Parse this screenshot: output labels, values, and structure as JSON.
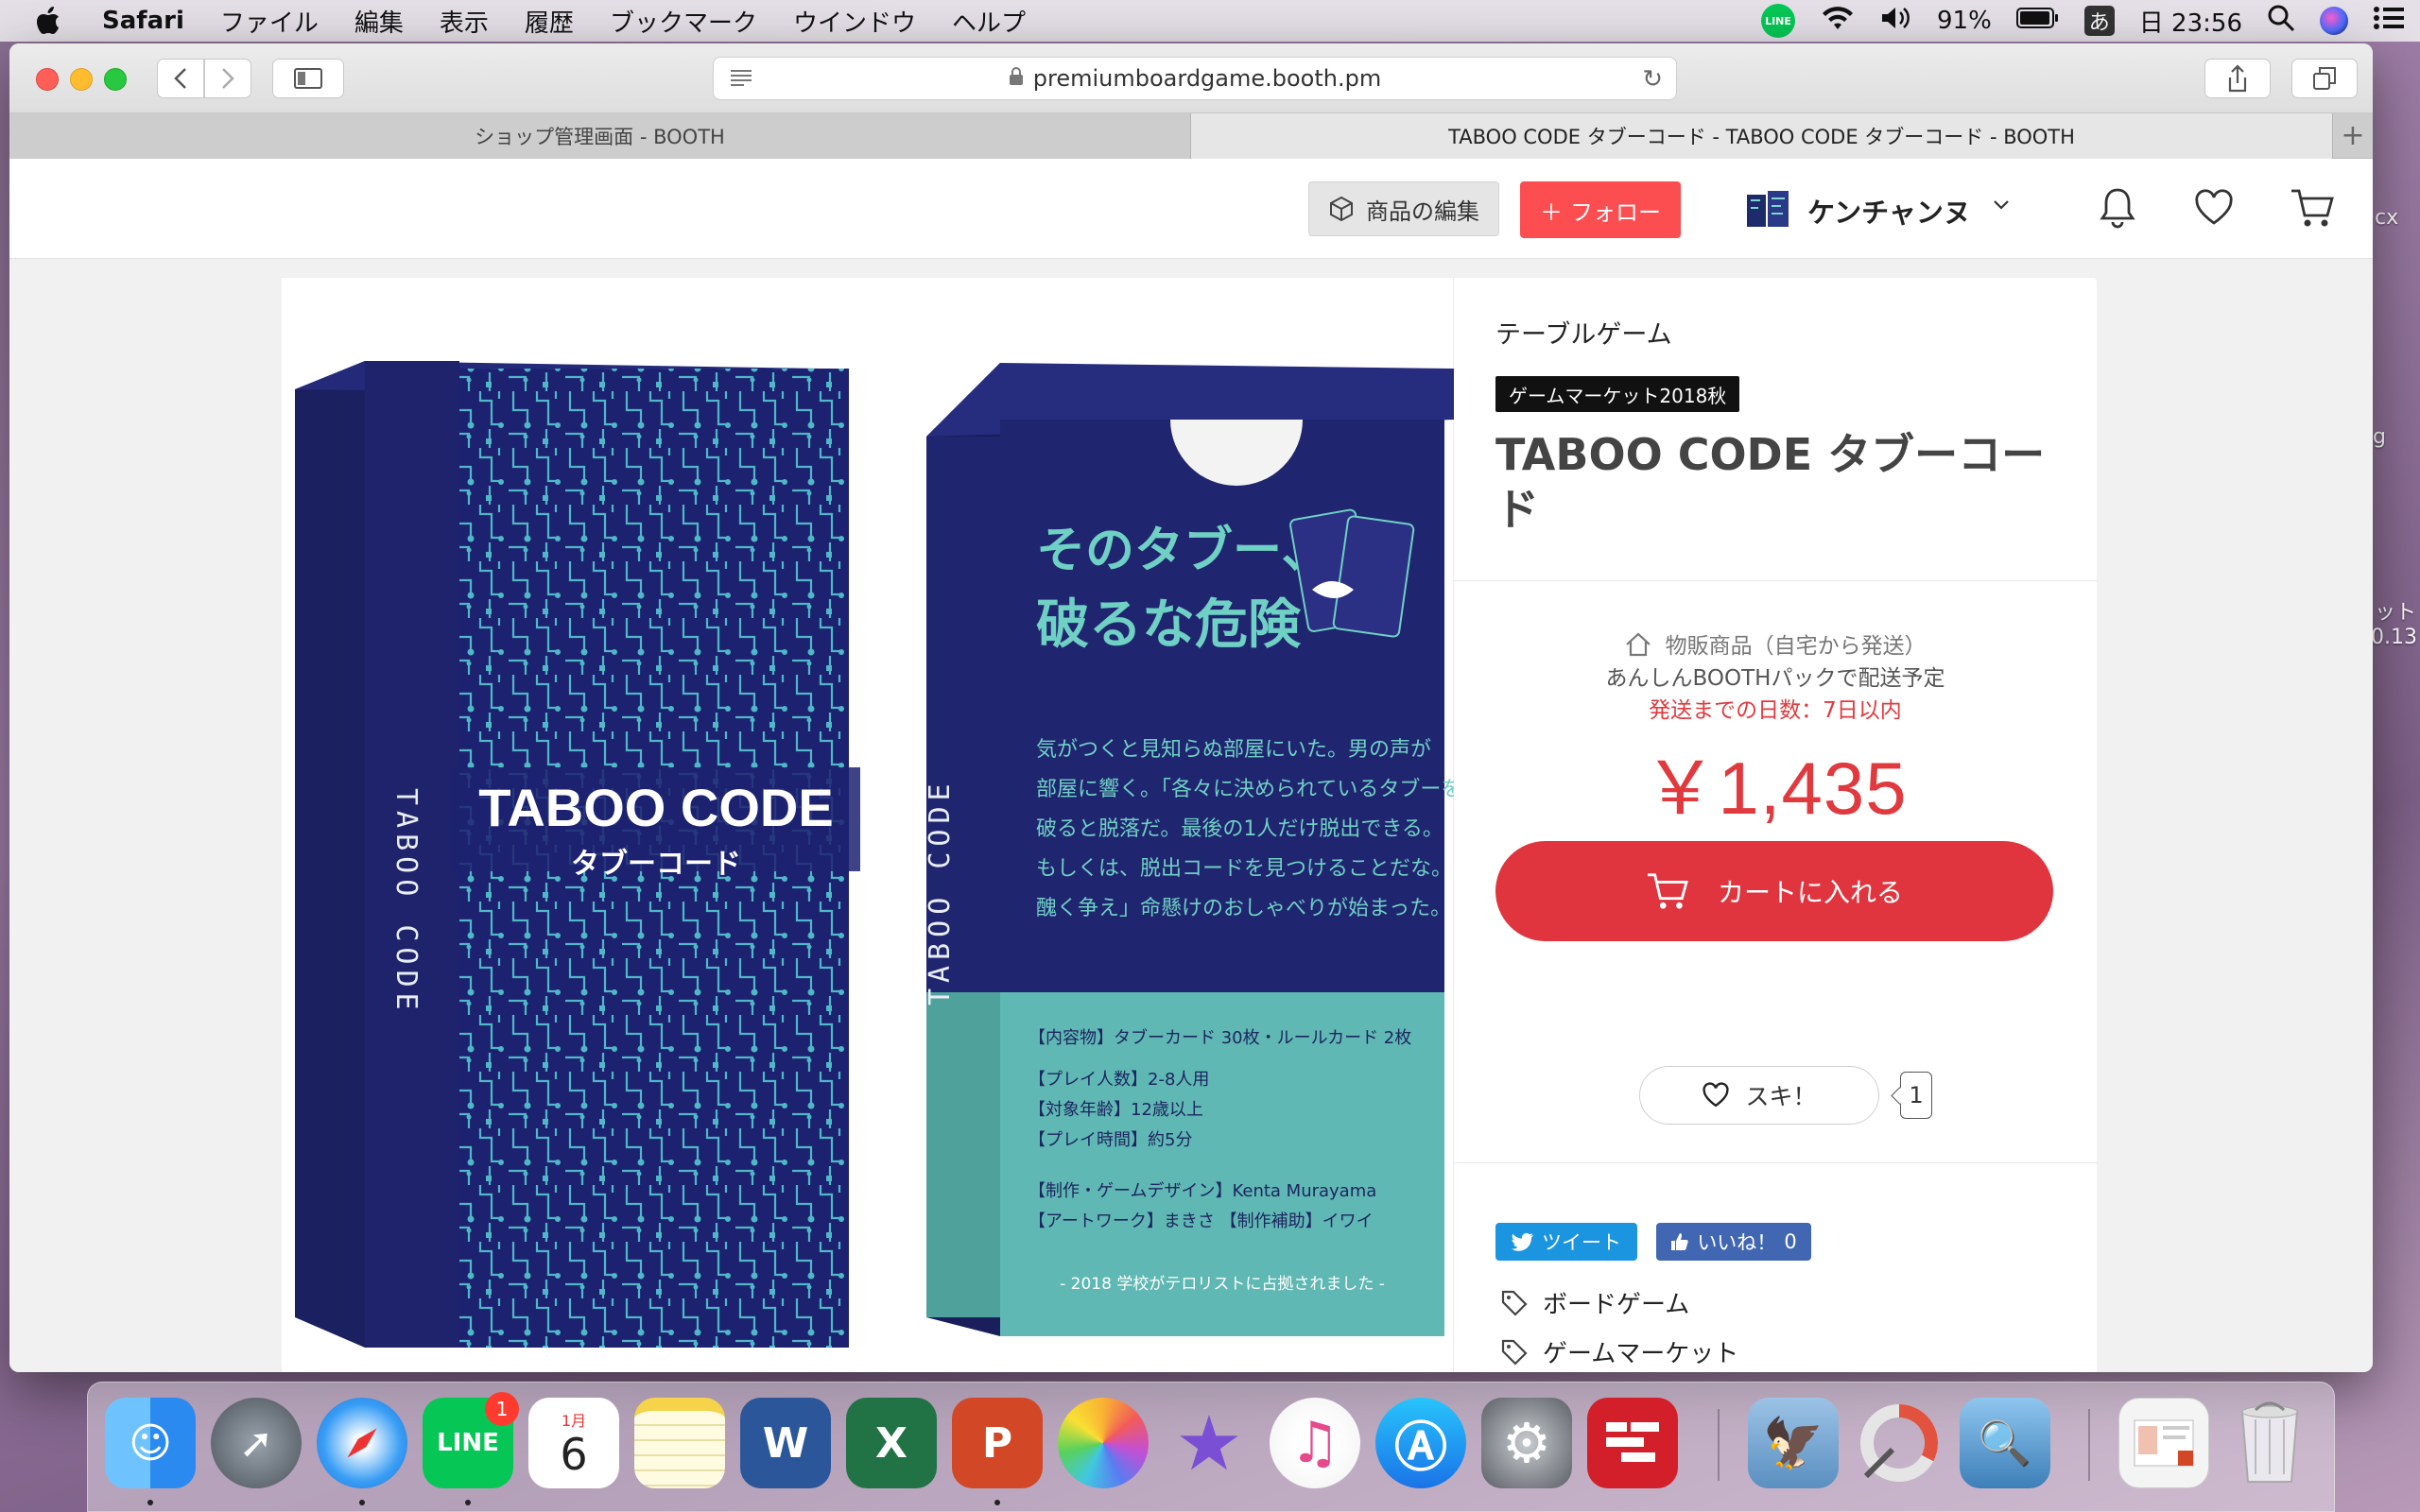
{
  "menubar": {
    "app_name": "Safari",
    "items": [
      "ファイル",
      "編集",
      "表示",
      "履歴",
      "ブックマーク",
      "ウインドウ",
      "ヘルプ"
    ],
    "battery": "91%",
    "ime": "あ",
    "clock": "日 23:56"
  },
  "desktop_fragments": [
    "cx",
    "g",
    "ット",
    "0.13"
  ],
  "browser": {
    "url": "premiumboardgame.booth.pm",
    "tabs": [
      {
        "title": "ショップ管理画面 - BOOTH",
        "active": false
      },
      {
        "title": "TABOO CODE タブーコード - TABOO CODE タブーコード - BOOTH",
        "active": true
      }
    ],
    "new_tab_label": "+"
  },
  "site_header": {
    "edit_label": "商品の編集",
    "follow_label": "フォロー",
    "shop_name": "ケンチャンヌ",
    "accent": "#fc4d50"
  },
  "product": {
    "category": "テーブルゲーム",
    "event_badge": "ゲームマーケット2018秋",
    "title": "TABOO CODE タブーコード",
    "shipping_type": "物販商品（自宅から発送）",
    "shipping_pack": "あんしんBOOTHパックで配送予定",
    "shipping_days": "発送までの日数：7日以内",
    "price": "￥1,435",
    "cart_label": "カートに入れる",
    "like_label": "スキ！",
    "like_count": "1",
    "tweet_label": "ツイート",
    "fb_label": "いいね！",
    "fb_count": "0",
    "tags": [
      "ボードゲーム",
      "ゲームマーケット"
    ],
    "price_color": "#e03a3e"
  },
  "box_image": {
    "spine_text": "TABOO CODE",
    "front_title": "TABOO CODE",
    "front_subtitle": "タブーコード",
    "back_spine_text": "TABOO CODE",
    "back_headline_1": "そのタブー、",
    "back_headline_2": "破るな危険",
    "back_story": [
      "気がつくと見知らぬ部屋にいた。男の声が",
      "部屋に響く。「各々に決められているタブーを",
      "破ると脱落だ。最後の1人だけ脱出できる。",
      "もしくは、脱出コードを見つけることだな。",
      "醜く争え」命懸けのおしゃべりが始まった。"
    ],
    "back_specs": [
      "【内容物】タブーカード 30枚・ルールカード 2枚",
      "【プレイ人数】2-8人用",
      "【対象年齢】12歳以上",
      "【プレイ時間】約5分",
      "【制作・ゲームデザイン】Kenta Murayama",
      "【アートワーク】まきさ 【制作補助】イワイ"
    ],
    "back_footer": "- 2018 学校がテロリストに占拠されました -"
  },
  "dock": {
    "apps": [
      {
        "name": "Finder",
        "icon": "finder-icon"
      },
      {
        "name": "Launchpad",
        "icon": "launchpad-icon"
      },
      {
        "name": "Safari",
        "icon": "safari-icon"
      },
      {
        "name": "LINE",
        "icon": "line-icon",
        "badge": "1"
      },
      {
        "name": "Calendar",
        "icon": "calendar-icon",
        "month": "1月",
        "day": "6"
      },
      {
        "name": "Notes",
        "icon": "notes-icon"
      },
      {
        "name": "Word",
        "icon": "word-icon",
        "letter": "W"
      },
      {
        "name": "Excel",
        "icon": "excel-icon",
        "letter": "X"
      },
      {
        "name": "PowerPoint",
        "icon": "powerpoint-icon",
        "letter": "P"
      },
      {
        "name": "Photos",
        "icon": "photos-icon"
      },
      {
        "name": "iMovie",
        "icon": "imovie-icon"
      },
      {
        "name": "iTunes",
        "icon": "itunes-icon"
      },
      {
        "name": "App Store",
        "icon": "appstore-icon"
      },
      {
        "name": "System Preferences",
        "icon": "system-preferences-icon"
      },
      {
        "name": "Board App",
        "icon": "board-app-icon"
      },
      {
        "name": "Eagle",
        "icon": "eagle-icon"
      },
      {
        "name": "Disk Tool",
        "icon": "disk-tool-icon"
      },
      {
        "name": "Preview",
        "icon": "preview-icon"
      },
      {
        "name": "Document",
        "icon": "document-icon"
      },
      {
        "name": "Trash",
        "icon": "trash-icon"
      }
    ]
  }
}
